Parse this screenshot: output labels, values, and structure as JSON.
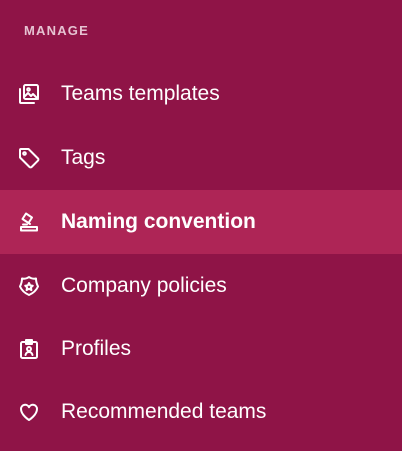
{
  "sidebar": {
    "section_title": "MANAGE",
    "items": [
      {
        "label": "Teams templates",
        "icon": "image-gallery-icon"
      },
      {
        "label": "Tags",
        "icon": "tag-icon"
      },
      {
        "label": "Naming convention",
        "icon": "stamp-icon",
        "active": true
      },
      {
        "label": "Company policies",
        "icon": "police-badge-icon"
      },
      {
        "label": "Profiles",
        "icon": "id-badge-icon"
      },
      {
        "label": "Recommended teams",
        "icon": "heart-icon"
      }
    ]
  },
  "colors": {
    "background": "#8f1447",
    "active_background": "#ae2556",
    "section_title": "#e6c3d2",
    "text": "#ffffff"
  }
}
